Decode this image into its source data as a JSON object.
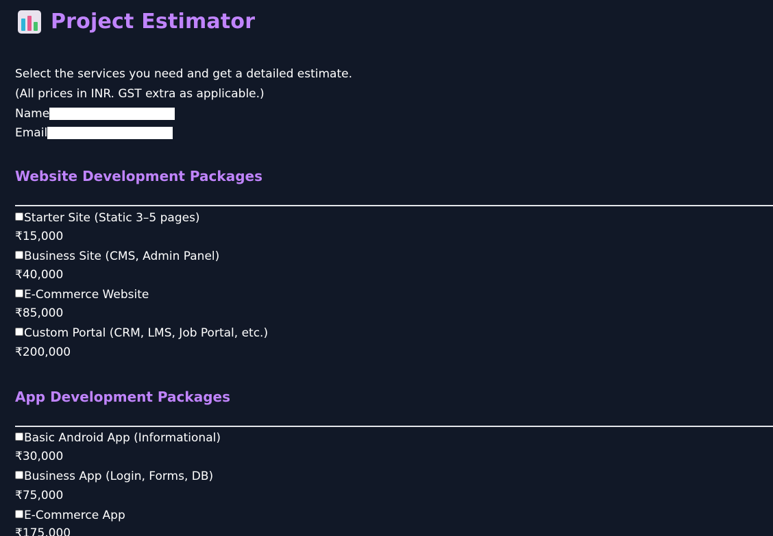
{
  "header": {
    "title": "Project Estimator",
    "icon": "bar-chart-icon"
  },
  "intro": {
    "line1": "Select the services you need and get a detailed estimate.",
    "line2": "(All prices in INR. GST extra as applicable.)"
  },
  "form": {
    "name_label": "Name",
    "name_value": "",
    "email_label": "Email",
    "email_value": ""
  },
  "sections": [
    {
      "title": "Website Development Packages",
      "items": [
        {
          "label": "Starter Site (Static 3–5 pages)",
          "price": "₹15,000",
          "checked": false
        },
        {
          "label": "Business Site (CMS, Admin Panel)",
          "price": "₹40,000",
          "checked": false
        },
        {
          "label": "E-Commerce Website",
          "price": "₹85,000",
          "checked": false
        },
        {
          "label": "Custom Portal (CRM, LMS, Job Portal, etc.)",
          "price": "₹200,000",
          "checked": false
        }
      ]
    },
    {
      "title": "App Development Packages",
      "items": [
        {
          "label": "Basic Android App (Informational)",
          "price": "₹30,000",
          "checked": false
        },
        {
          "label": "Business App (Login, Forms, DB)",
          "price": "₹75,000",
          "checked": false
        },
        {
          "label": "E-Commerce App",
          "price": "₹175,000",
          "checked": false
        }
      ]
    }
  ],
  "colors": {
    "background": "#111827",
    "accent": "#c084fc",
    "text": "#ffffff"
  }
}
